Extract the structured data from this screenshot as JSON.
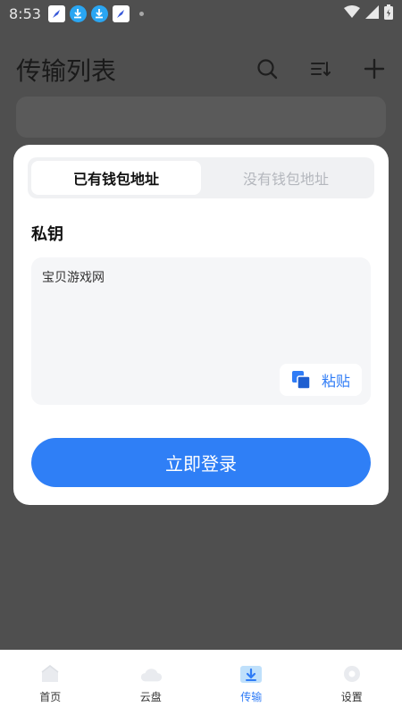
{
  "status_bar": {
    "time": "8:53"
  },
  "header": {
    "title": "传输列表"
  },
  "modal": {
    "tabs": [
      {
        "label": "已有钱包地址",
        "active": true
      },
      {
        "label": "没有钱包地址",
        "active": false
      }
    ],
    "private_key_label": "私钥",
    "private_key_value": "宝贝游戏网",
    "paste_label": "粘贴",
    "login_label": "立即登录"
  },
  "bottom_nav": {
    "items": [
      {
        "label": "首页",
        "icon": "home-icon",
        "active": false
      },
      {
        "label": "云盘",
        "icon": "cloud-icon",
        "active": false
      },
      {
        "label": "传输",
        "icon": "transfer-icon",
        "active": true
      },
      {
        "label": "设置",
        "icon": "settings-icon",
        "active": false
      }
    ]
  },
  "colors": {
    "accent": "#2f7ff6",
    "overlay": "#4f4f4f"
  }
}
